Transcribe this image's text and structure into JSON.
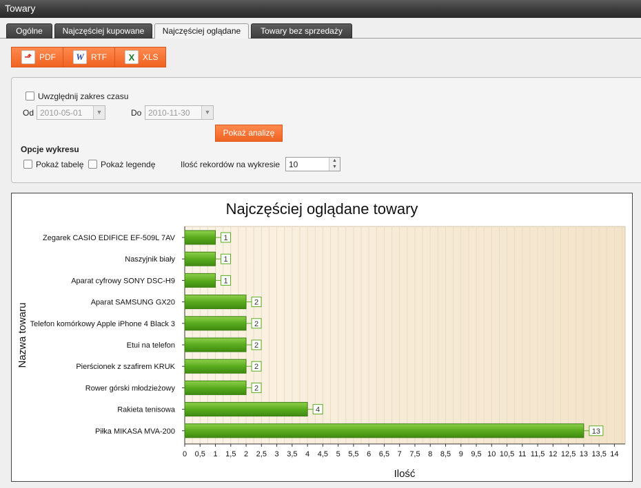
{
  "window": {
    "title": "Towary"
  },
  "tabs": [
    {
      "label": "Ogólne",
      "active": false
    },
    {
      "label": "Najczęściej kupowane",
      "active": false
    },
    {
      "label": "Najczęściej oglądane",
      "active": true
    },
    {
      "label": "Towary bez sprzedaży",
      "active": false
    }
  ],
  "export": {
    "pdf": {
      "label": "PDF",
      "icon": "pdf-icon"
    },
    "rtf": {
      "label": "RTF",
      "icon": "word-icon"
    },
    "xls": {
      "label": "XLS",
      "icon": "excel-icon"
    }
  },
  "filter": {
    "include_range_label": "Uwzględnij zakres czasu",
    "include_range_checked": false,
    "from_label": "Od",
    "from_value": "2010-05-01",
    "to_label": "Do",
    "to_value": "2010-11-30",
    "analyze_button": "Pokaż analizę"
  },
  "options": {
    "heading": "Opcje wykresu",
    "show_table_label": "Pokaż tabelę",
    "show_table_checked": false,
    "show_legend_label": "Pokaż legendę",
    "show_legend_checked": false,
    "records_label": "Ilość rekordów na wykresie",
    "records_value": "10"
  },
  "chart_data": {
    "type": "bar",
    "orientation": "horizontal",
    "title": "Najczęściej oglądane towary",
    "xlabel": "Ilość",
    "ylabel": "Nazwa towaru",
    "categories": [
      "Zegarek CASIO EDIFICE EF-509L 7AV",
      "Naszyjnik biały",
      "Aparat cyfrowy SONY DSC-H9",
      "Aparat SAMSUNG GX20",
      "Telefon komórkowy Apple iPhone 4 Black 3",
      "Etui na telefon",
      "Pierścionek z szafirem KRUK",
      "Rower górski młodzieżowy",
      "Rakieta tenisowa",
      "Piłka MIKASA MVA-200"
    ],
    "values": [
      1,
      1,
      1,
      2,
      2,
      2,
      2,
      2,
      4,
      13
    ],
    "xlim": [
      0,
      14.35
    ],
    "xticks": [
      "0",
      "0,5",
      "1",
      "1,5",
      "2",
      "2,5",
      "3",
      "3,5",
      "4",
      "4,5",
      "5",
      "5,5",
      "6",
      "6,5",
      "7",
      "7,5",
      "8",
      "8,5",
      "9",
      "9,5",
      "10",
      "10,5",
      "11",
      "11,5",
      "12",
      "12,5",
      "13",
      "13,5",
      "14"
    ],
    "grid": true,
    "colors": {
      "bar": "#5aab1e",
      "label_border": "#5aab1e",
      "plot_bg": "#f6ead7"
    }
  }
}
